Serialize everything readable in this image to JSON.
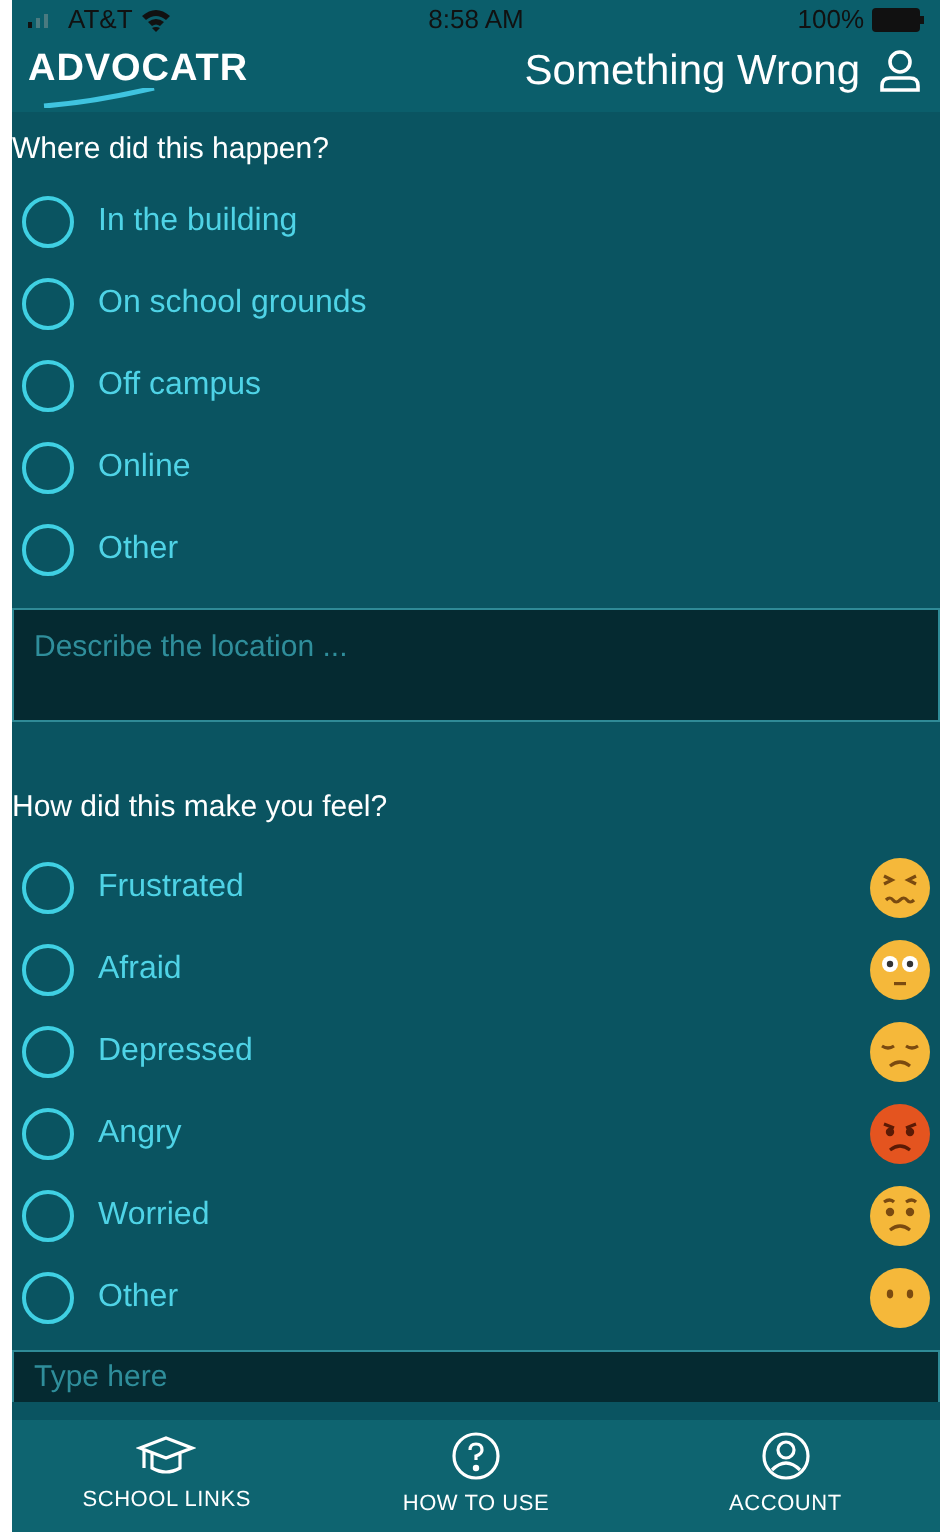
{
  "status_bar": {
    "carrier": "AT&T",
    "time": "8:58 AM",
    "battery": "100%"
  },
  "header": {
    "logo": "ADVOCATR",
    "title": "Something Wrong"
  },
  "location_question": {
    "prompt": "Where did this happen?",
    "options": [
      {
        "label": "In the building",
        "selected": false
      },
      {
        "label": "On school grounds",
        "selected": false
      },
      {
        "label": "Off campus",
        "selected": false
      },
      {
        "label": "Online",
        "selected": false
      },
      {
        "label": "Other",
        "selected": false
      }
    ],
    "field": {
      "placeholder": "Describe the location ..."
    }
  },
  "feeling_question": {
    "prompt": "How did this make you feel?",
    "options": [
      {
        "label": "Frustrated",
        "selected": false
      },
      {
        "label": "Afraid",
        "selected": false
      },
      {
        "label": "Depressed",
        "selected": false
      },
      {
        "label": "Angry",
        "selected": false
      },
      {
        "label": "Worried",
        "selected": false
      },
      {
        "label": "Other",
        "selected": false
      }
    ],
    "field": {
      "placeholder": "Type here"
    }
  },
  "tab_bar": [
    {
      "label": "SCHOOL LINKS"
    },
    {
      "label": "HOW TO USE"
    },
    {
      "label": "ACCOUNT"
    }
  ]
}
